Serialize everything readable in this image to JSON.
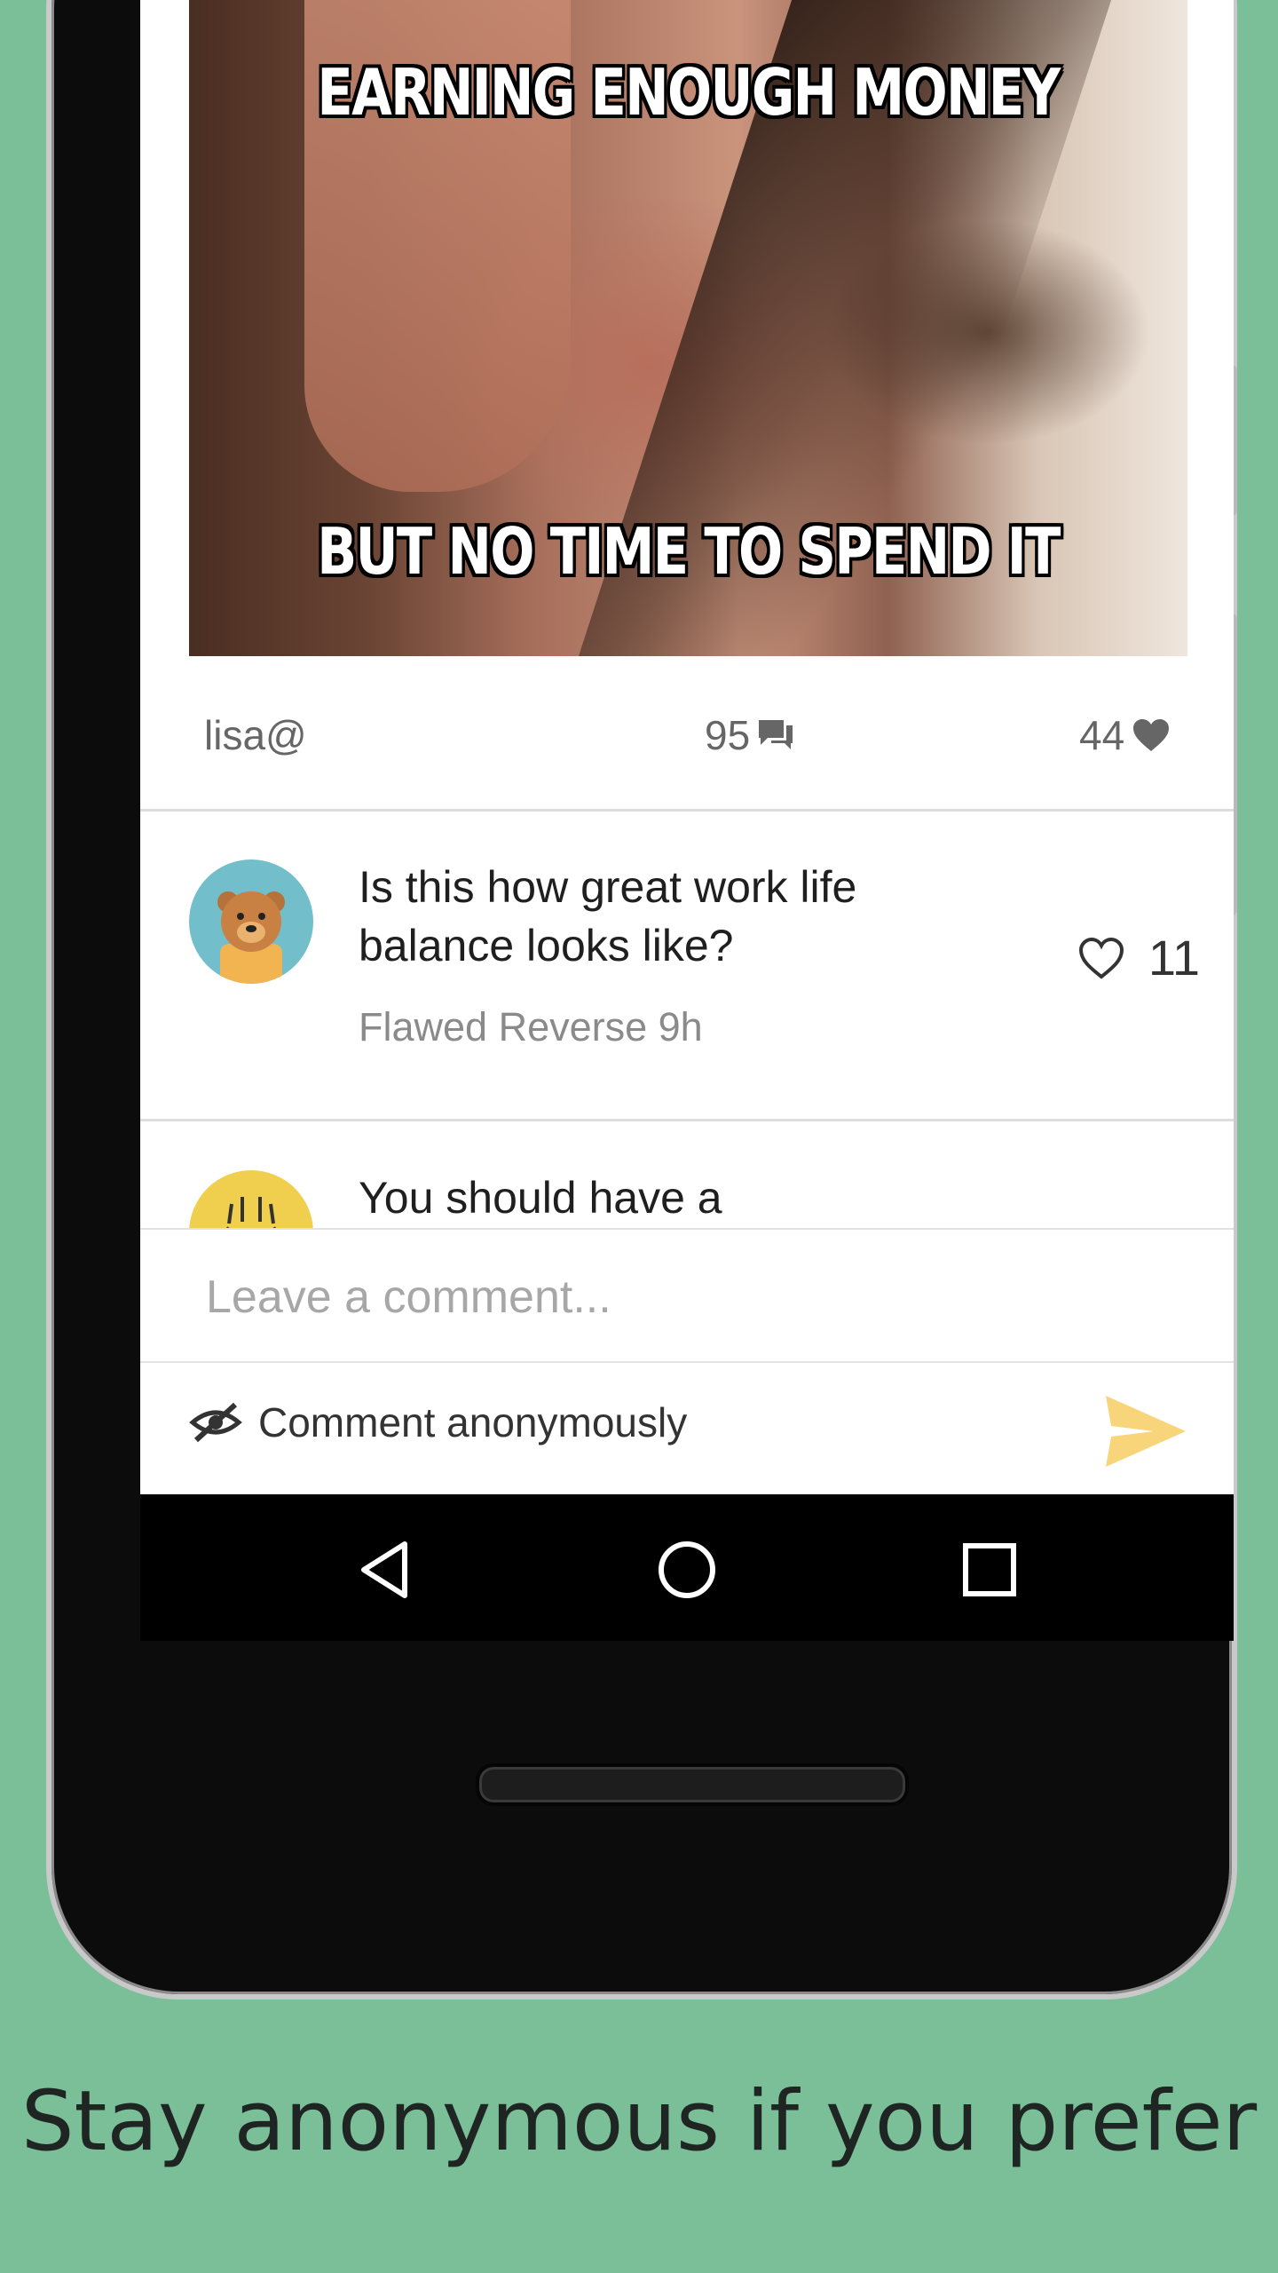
{
  "post": {
    "image_caption_top": "EARNING ENOUGH MONEY",
    "image_caption_bottom": "BUT NO TIME TO SPEND IT",
    "author": "lisa@",
    "comment_count": "95",
    "like_count": "44"
  },
  "comments": [
    {
      "avatar_icon": "bear-icon",
      "text": "Is this how great work life balance looks like?",
      "meta": "Flawed Reverse 9h",
      "likes": "11"
    },
    {
      "avatar_icon": "monster-icon",
      "text": "You should have a"
    }
  ],
  "composer": {
    "placeholder": "Leave a comment...",
    "anonymous_label": "Comment anonymously",
    "send_color": "#f8d57a"
  },
  "colors": {
    "appbar": "#009688",
    "background": "#7bbf98"
  },
  "caption": "Stay anonymous if you prefer"
}
